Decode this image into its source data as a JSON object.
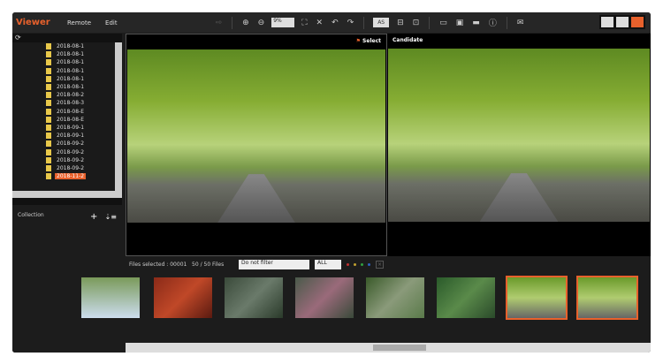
{
  "app": {
    "title": "Viewer",
    "menu": [
      "Remote",
      "Edit"
    ]
  },
  "toolbar": {
    "zoom_value": "9%",
    "as_label": "AS"
  },
  "tree": {
    "folders": [
      "2018-08-1",
      "2018-08-1",
      "2018-08-1",
      "2018-08-1",
      "2018-08-1",
      "2018-08-1",
      "2018-08-2",
      "2018-08-3",
      "2018-08-E",
      "2018-08-E",
      "2018-09-1",
      "2018-09-1",
      "2018-09-2",
      "2018-09-2",
      "2018-09-2",
      "2018-09-2",
      "2018-11-2"
    ],
    "selected_index": 16
  },
  "collection": {
    "label": "Collection",
    "add": "+",
    "import": "⇣≡"
  },
  "viewer": {
    "select_label": "Select",
    "candidate_label": "Candidate"
  },
  "filter": {
    "status": "Files selected : 00001   50 / 50 Files",
    "filter_value": "Do not filter",
    "rating_value": "ALL",
    "colors": [
      "#c03030",
      "#c0a030",
      "#30a040",
      "#3060c0"
    ]
  },
  "thumbnails": [
    {
      "bg": "linear-gradient(135deg,#8a2a18,#c04828,#5a1a10)",
      "selected": false
    },
    {
      "bg": "linear-gradient(135deg,#3a4a3a,#6a7a6a,#2a3a2a)",
      "selected": false
    },
    {
      "bg": "linear-gradient(135deg,#4a5a4a,#9a6a7a,#3a4a3a)",
      "selected": false
    },
    {
      "bg": "linear-gradient(135deg,#3a5a2a,#8a9a7a,#5a7a4a)",
      "selected": false
    },
    {
      "bg": "linear-gradient(135deg,#2a5a2a,#5a8a4a,#2a4a2a)",
      "selected": false
    },
    {
      "bg": "linear-gradient(180deg,#6a9a2a,#b0cc70,#666)",
      "selected": true
    },
    {
      "bg": "linear-gradient(180deg,#6a9a2a,#b0cc70,#666)",
      "selected": true
    }
  ]
}
